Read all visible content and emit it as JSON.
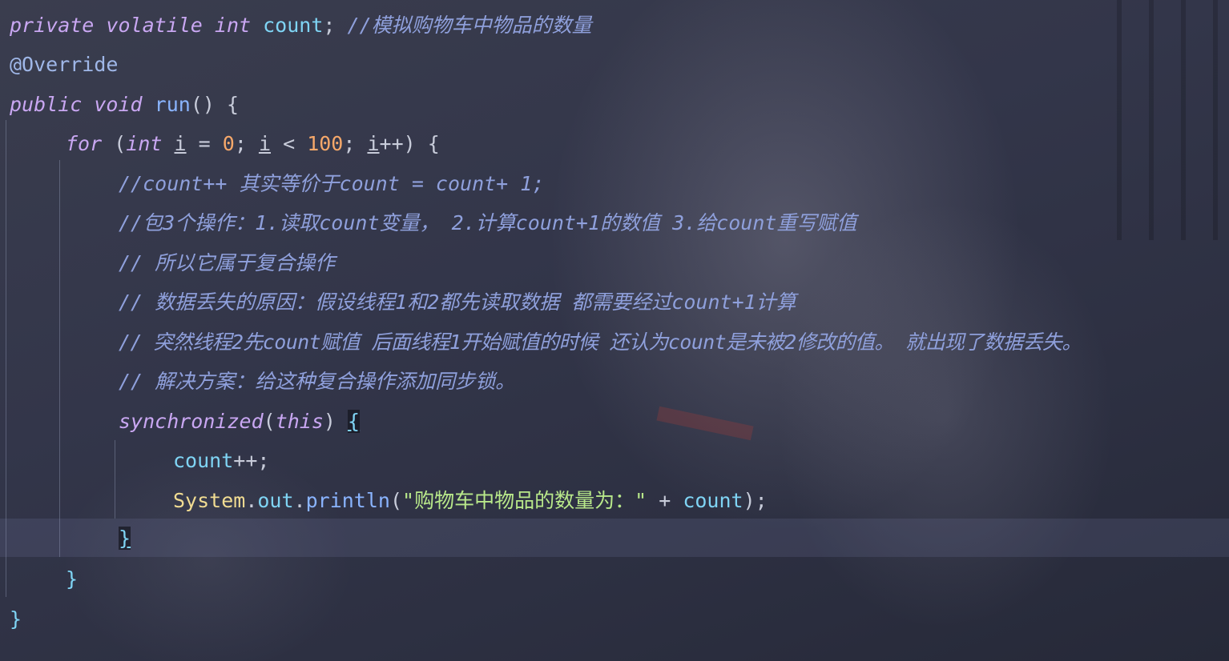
{
  "editor": {
    "line1": {
      "kw1": "private",
      "kw2": "volatile",
      "kw3": "int",
      "var": "count",
      "semi": ";",
      "comment": "//模拟购物车中物品的数量"
    },
    "line2": {
      "annotation": "@Override"
    },
    "line3": {
      "kw1": "public",
      "kw2": "void",
      "fn": "run",
      "rest": "() {"
    },
    "line4": {
      "kw1": "for",
      "p1": "(",
      "kw2": "int",
      "i1": "i",
      "eq": "=",
      "n0": "0",
      "semi1": ";",
      "i2": "i",
      "lt": "<",
      "n100": "100",
      "semi2": ";",
      "i3": "i",
      "inc": "++) {"
    },
    "line5": {
      "comment": "//count++ 其实等价于count = count+ 1;"
    },
    "line6": {
      "comment": "//包3个操作：1.读取count变量， 2.计算count+1的数值 3.给count重写赋值"
    },
    "line7": {
      "comment": "// 所以它属于复合操作"
    },
    "line8": {
      "comment": "// 数据丢失的原因：假设线程1和2都先读取数据 都需要经过count+1计算"
    },
    "line9": {
      "comment": "// 突然线程2先count赋值 后面线程1开始赋值的时候 还认为count是未被2修改的值。 就出现了数据丢失。"
    },
    "line10": {
      "comment": "// 解决方案：给这种复合操作添加同步锁。"
    },
    "line11": {
      "kw1": "synchronized",
      "p1": "(",
      "kw2": "this",
      "p2": ")",
      "brace": "{"
    },
    "line12": {
      "var": "count",
      "rest": "++;"
    },
    "line13": {
      "cls": "System",
      "dot1": ".",
      "field": "out",
      "dot2": ".",
      "fn": "println",
      "p1": "(",
      "str": "\"购物车中物品的数量为：\"",
      "plus": "+",
      "var": "count",
      "end": ");"
    },
    "line14": {
      "brace": "}"
    },
    "line15": {
      "brace": "}"
    },
    "line16": {
      "brace": "}"
    }
  },
  "colors": {
    "background": "#2e3243",
    "keyword": "#c9a7f2",
    "comment": "#8fa0dc",
    "variable": "#7fd4f4",
    "number": "#f6a86a",
    "string": "#b8e88a",
    "class": "#f1dc92"
  }
}
